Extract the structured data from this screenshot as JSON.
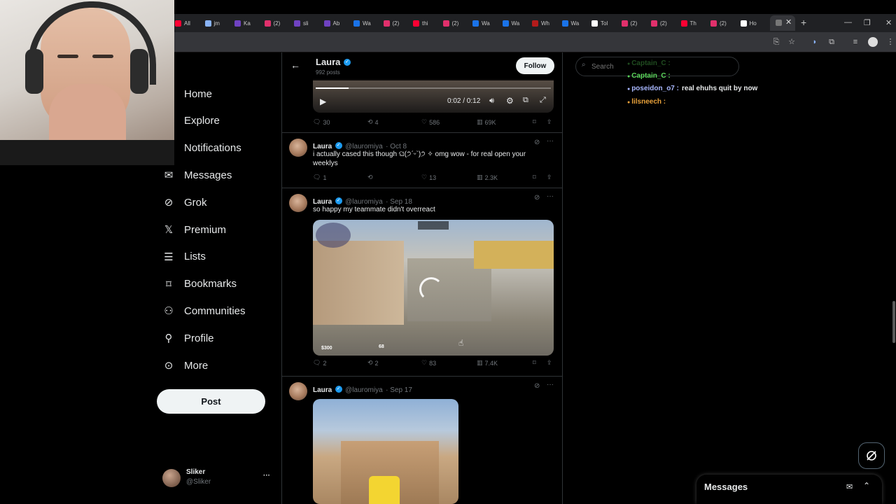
{
  "browser": {
    "tabs": [
      {
        "label": "All",
        "color": "#ff0033"
      },
      {
        "label": "jm",
        "color": "#8ab4f8"
      },
      {
        "label": "Ka",
        "color": "#6f42c1"
      },
      {
        "label": "(2)",
        "color": "#e1306c"
      },
      {
        "label": "sli",
        "color": "#6f42c1"
      },
      {
        "label": "Ab",
        "color": "#6f42c1"
      },
      {
        "label": "Wa",
        "color": "#1a73e8"
      },
      {
        "label": "(2)",
        "color": "#e1306c"
      },
      {
        "label": "thi",
        "color": "#ff0033"
      },
      {
        "label": "(2)",
        "color": "#e1306c"
      },
      {
        "label": "Wa",
        "color": "#1a73e8"
      },
      {
        "label": "Wa",
        "color": "#1a73e8"
      },
      {
        "label": "Wh",
        "color": "#b31b1b"
      },
      {
        "label": "Wa",
        "color": "#1a73e8"
      },
      {
        "label": "Tol",
        "color": "#ffffff"
      },
      {
        "label": "(2)",
        "color": "#e1306c"
      },
      {
        "label": "(2)",
        "color": "#e1306c"
      },
      {
        "label": "Th",
        "color": "#ff0033"
      },
      {
        "label": "(2)",
        "color": "#e1306c"
      },
      {
        "label": "Ho",
        "color": "#ffffff"
      }
    ]
  },
  "nav": {
    "items": [
      {
        "label": "Home",
        "icon": "home-icon"
      },
      {
        "label": "Explore",
        "icon": "search-icon"
      },
      {
        "label": "Notifications",
        "icon": "bell-icon"
      },
      {
        "label": "Messages",
        "icon": "envelope-icon"
      },
      {
        "label": "Grok",
        "icon": "grok-icon"
      },
      {
        "label": "Premium",
        "icon": "x-logo-icon"
      },
      {
        "label": "Lists",
        "icon": "list-icon"
      },
      {
        "label": "Bookmarks",
        "icon": "bookmark-icon"
      },
      {
        "label": "Communities",
        "icon": "communities-icon"
      },
      {
        "label": "Profile",
        "icon": "person-icon"
      },
      {
        "label": "More",
        "icon": "more-circle-icon"
      }
    ],
    "post_label": "Post",
    "account": {
      "name": "Sliker",
      "handle": "@Sliker",
      "more": "···"
    }
  },
  "profile_header": {
    "name": "Laura",
    "posts": "992 posts",
    "follow": "Follow"
  },
  "video_controls": {
    "time": "0:02 / 0:12"
  },
  "tweets": [
    {
      "stats": {
        "replies": "30",
        "reposts": "4",
        "likes": "586",
        "views": "69K"
      }
    },
    {
      "name": "Laura",
      "handle": "@lauromiya",
      "date": "· Oct 8",
      "text": "i actually cased this though ଘ(੭ˊᵕˋ)੭ ✧ omg wow - for real open your weeklys",
      "stats": {
        "replies": "1",
        "reposts": "",
        "likes": "13",
        "views": "2.3K"
      }
    },
    {
      "name": "Laura",
      "handle": "@lauromiya",
      "date": "· Sep 18",
      "text": "so happy my teammate didn't overreact",
      "game_hud": {
        "money": "$300",
        "score": "68"
      },
      "stats": {
        "replies": "2",
        "reposts": "2",
        "likes": "83",
        "views": "7.4K"
      }
    },
    {
      "name": "Laura",
      "handle": "@lauromiya",
      "date": "· Sep 17"
    }
  ],
  "search": {
    "placeholder": "Search"
  },
  "chat": [
    {
      "user": "Captain_C :",
      "msg": "",
      "color": "#5bd75b",
      "faded": true
    },
    {
      "user": "Captain_C :",
      "msg": "",
      "color": "#5bd75b",
      "faded": false
    },
    {
      "user": "poseidon_o7 :",
      "msg": "real ehuhs quit by now",
      "color": "#a9b8ff",
      "faded": false
    },
    {
      "user": "lilsneech :",
      "msg": "",
      "color": "#e8a13a",
      "faded": false
    }
  ],
  "messages_drawer": {
    "title": "Messages"
  }
}
